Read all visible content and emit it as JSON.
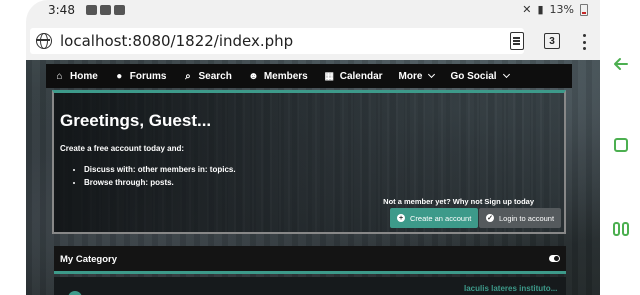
{
  "status_bar": {
    "time": "3:48",
    "battery": "13%"
  },
  "browser": {
    "url": "localhost:8080/1822/index.php",
    "tab_count": "3"
  },
  "nav": {
    "items": [
      {
        "label": "Home",
        "icon": "home-icon"
      },
      {
        "label": "Forums",
        "icon": "comments-icon"
      },
      {
        "label": "Search",
        "icon": "search-icon"
      },
      {
        "label": "Members",
        "icon": "users-icon"
      },
      {
        "label": "Calendar",
        "icon": "calendar-icon"
      },
      {
        "label": "More",
        "icon": "chevron-down-icon"
      },
      {
        "label": "Go Social",
        "icon": "chevron-down-icon"
      }
    ]
  },
  "hero": {
    "title": "Greetings, Guest...",
    "subtitle": "Create a free account today and:",
    "bullets": [
      "Discuss with: other members in: topics.",
      "Browse through: posts."
    ],
    "signup_prompt": "Not a member yet? Why not Sign up today",
    "create_button": "Create an account",
    "login_button": "Login to account"
  },
  "category": {
    "title": "My Category"
  },
  "forum": {
    "last_post_link": "Iaculis lateres instituto..."
  },
  "colors": {
    "accent": "#3d9a8a",
    "nav_bg": "#0e0e0e",
    "android_nav": "#4caf50"
  }
}
